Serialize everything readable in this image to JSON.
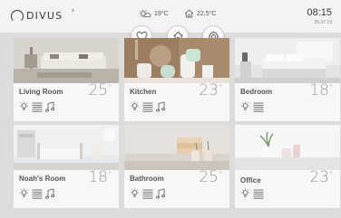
{
  "header": {
    "logo_text": "DIVUS",
    "logo_mark": "®",
    "outdoor_temp": "19°C",
    "indoor_temp": "22,5°C",
    "time": "08:15",
    "date": "25.07.19"
  },
  "quick_actions": [
    {
      "icon": "heart-icon"
    },
    {
      "icon": "home-icon"
    },
    {
      "icon": "gear-icon"
    }
  ],
  "rooms": [
    {
      "name": "Living Room",
      "temp": "25",
      "icons": [
        "light",
        "blinds",
        "music"
      ]
    },
    {
      "name": "Kitchen",
      "temp": "23",
      "icons": [
        "light",
        "blinds",
        "music"
      ]
    },
    {
      "name": "Bedroom",
      "temp": "18",
      "icons": [
        "light",
        "blinds"
      ]
    },
    {
      "name": "Noah's Room",
      "temp": "18",
      "icons": [
        "light",
        "blinds",
        "music"
      ]
    },
    {
      "name": "Bathroom",
      "temp": "25",
      "icons": [
        "light",
        "blinds",
        "music"
      ]
    },
    {
      "name": "Office",
      "temp": "23",
      "icons": [
        "light",
        "blinds"
      ]
    }
  ],
  "degree_symbol": "°"
}
